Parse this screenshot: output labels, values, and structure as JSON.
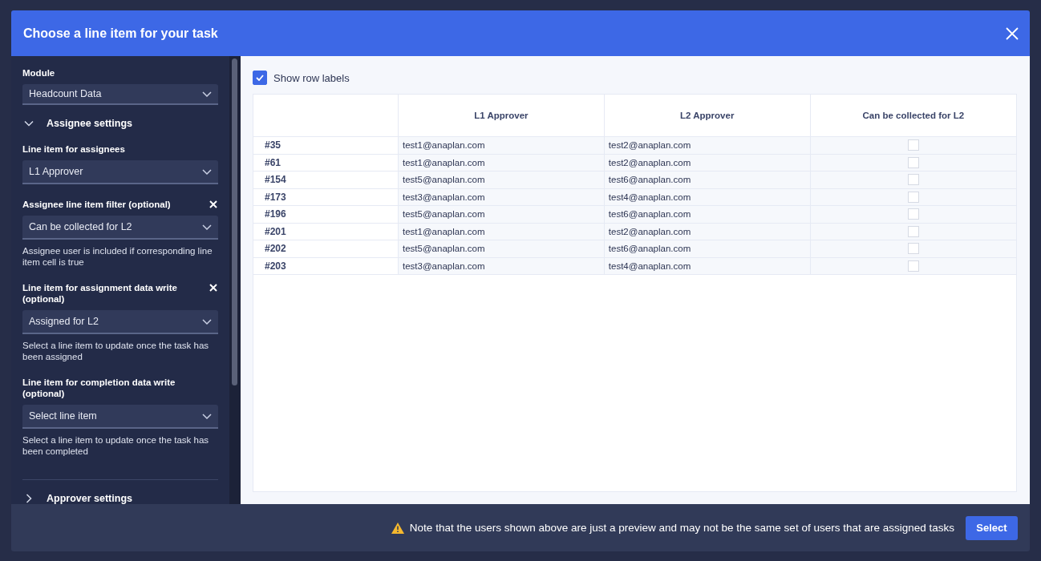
{
  "dialog": {
    "title": "Choose a line item for your task"
  },
  "sidebar": {
    "module": {
      "label": "Module",
      "value": "Headcount Data"
    },
    "sections": [
      {
        "title": "Assignee settings",
        "expanded": true,
        "fields": [
          {
            "label": "Line item for assignees",
            "clearable": false,
            "value": "L1 Approver"
          },
          {
            "label": "Assignee line item filter (optional)",
            "clearable": true,
            "value": "Can be collected for L2",
            "hint": "Assignee user is included if corresponding line item cell is true"
          },
          {
            "label": "Line item for assignment data write (optional)",
            "clearable": true,
            "value": "Assigned for L2",
            "hint": "Select a line item to update once the task has been assigned"
          },
          {
            "label": "Line item for completion data write (optional)",
            "clearable": false,
            "placeholder": "Select line item",
            "hint": "Select a line item to update once the task has been completed"
          }
        ]
      },
      {
        "title": "Approver settings",
        "expanded": false
      }
    ]
  },
  "preview": {
    "show_row_labels": {
      "label": "Show row labels",
      "checked": true
    },
    "table": {
      "columns": [
        "L1 Approver",
        "L2 Approver",
        "Can be collected for L2"
      ],
      "rows": [
        {
          "label": "#35",
          "l1": "test1@anaplan.com",
          "l2": "test2@anaplan.com",
          "checked": false
        },
        {
          "label": "#61",
          "l1": "test1@anaplan.com",
          "l2": "test2@anaplan.com",
          "checked": false
        },
        {
          "label": "#154",
          "l1": "test5@anaplan.com",
          "l2": "test6@anaplan.com",
          "checked": false
        },
        {
          "label": "#173",
          "l1": "test3@anaplan.com",
          "l2": "test4@anaplan.com",
          "checked": false
        },
        {
          "label": "#196",
          "l1": "test5@anaplan.com",
          "l2": "test6@anaplan.com",
          "checked": false
        },
        {
          "label": "#201",
          "l1": "test1@anaplan.com",
          "l2": "test2@anaplan.com",
          "checked": false
        },
        {
          "label": "#202",
          "l1": "test5@anaplan.com",
          "l2": "test6@anaplan.com",
          "checked": false
        },
        {
          "label": "#203",
          "l1": "test3@anaplan.com",
          "l2": "test4@anaplan.com",
          "checked": false
        }
      ]
    }
  },
  "footer": {
    "note": "Note that the users shown above are just a preview and may not be the same set of users that are assigned tasks",
    "button": "Select"
  }
}
